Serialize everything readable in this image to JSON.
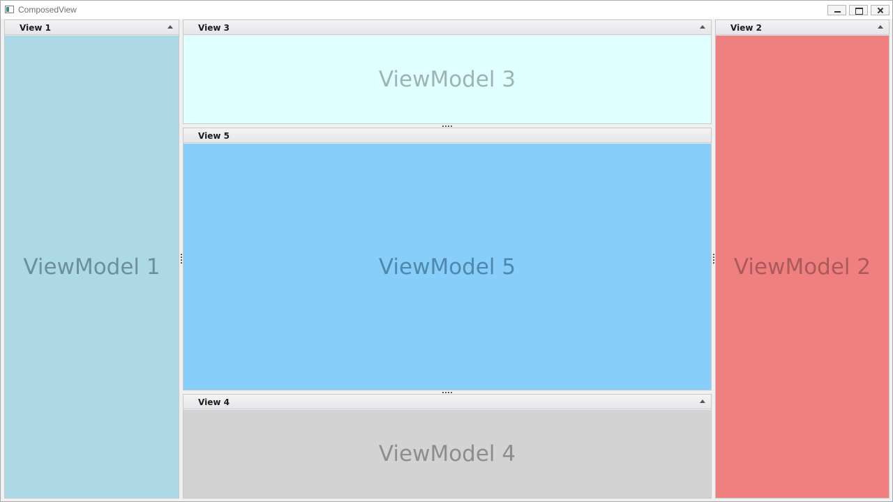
{
  "window": {
    "title": "ComposedView",
    "icon": "app-icon",
    "controls": [
      "minimize-icon",
      "maximize-icon",
      "close-icon"
    ]
  },
  "panels": {
    "view1": {
      "header": "View 1",
      "content": "ViewModel 1",
      "background": "#add8e6",
      "text_color": "#6d8f9a",
      "collapsible": true
    },
    "view3": {
      "header": "View 3",
      "content": "ViewModel 3",
      "background": "#e0ffff",
      "text_color": "#9fb3b3",
      "collapsible": true
    },
    "view5": {
      "header": "View 5",
      "content": "ViewModel 5",
      "background": "#87cefa",
      "text_color": "#4f88ad",
      "collapsible": false
    },
    "view4": {
      "header": "View 4",
      "content": "ViewModel 4",
      "background": "#d3d3d3",
      "text_color": "#8d8d8d",
      "collapsible": true
    },
    "view2": {
      "header": "View 2",
      "content": "ViewModel 2",
      "background": "#f08080",
      "text_color": "#aa5a5a",
      "collapsible": true
    }
  }
}
